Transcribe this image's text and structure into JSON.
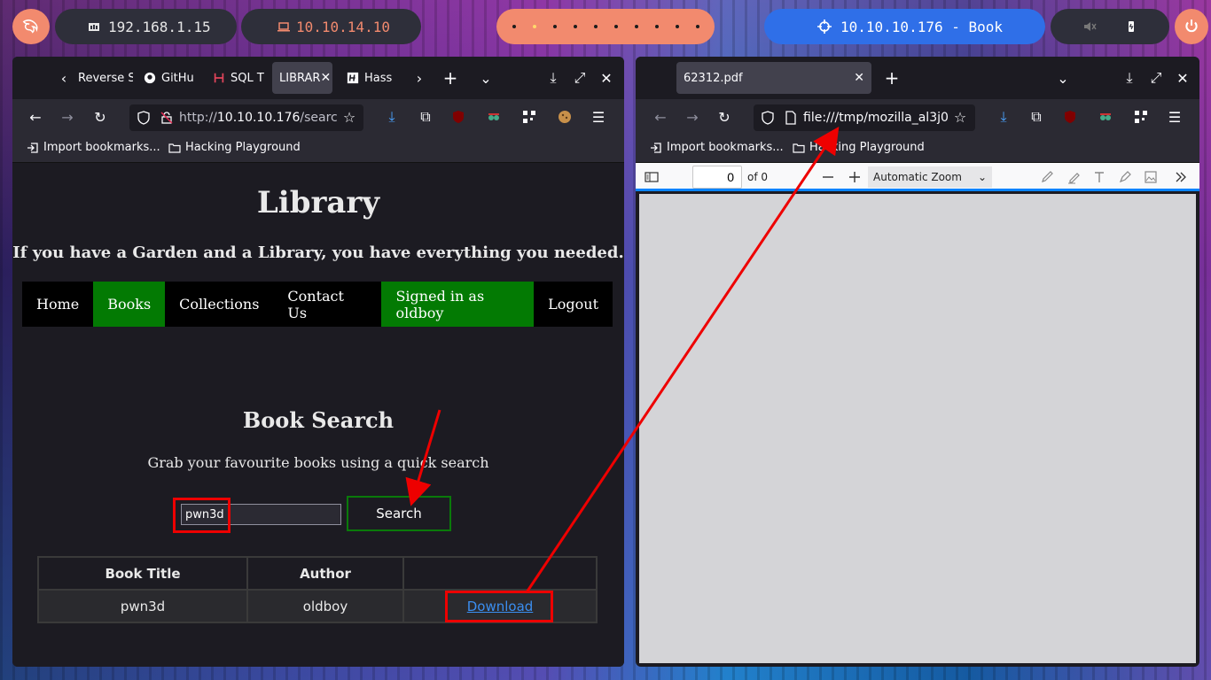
{
  "topbar": {
    "ip_local": "192.168.1.15",
    "ip_vpn": "10.10.14.10",
    "target": "10.10.10.176 - Book"
  },
  "left_browser": {
    "tabs": [
      "Reverse S",
      "GitHu",
      "SQL T",
      "LIBRAR",
      "Hass"
    ],
    "url_prefix": "http://",
    "url_host": "10.10.10.176",
    "url_path": "/searc",
    "bookmarks": [
      "Import bookmarks...",
      "Hacking Playground"
    ]
  },
  "page": {
    "title": "Library",
    "subtitle": "If you have a Garden and a Library, you have everything you needed.",
    "nav": [
      "Home",
      "Books",
      "Collections",
      "Contact Us",
      "Signed in as oldboy",
      "Logout"
    ],
    "search_title": "Book Search",
    "search_sub": "Grab your favourite books using a quick search",
    "search_value": "pwn3d",
    "search_button": "Search",
    "table_headers": [
      "Book Title",
      "Author",
      ""
    ],
    "rows": [
      {
        "title": "pwn3d",
        "author": "oldboy",
        "action": "Download"
      }
    ]
  },
  "right_browser": {
    "tab_title": "62312.pdf",
    "url": "file:///tmp/mozilla_al3j0",
    "bookmarks": [
      "Import bookmarks...",
      "Hacking Playground"
    ],
    "pdf_page": "0",
    "pdf_of": "of 0",
    "zoom": "Automatic Zoom"
  },
  "colors": {
    "accent_orange": "#f28a6e",
    "target_blue": "#2f6fe8",
    "nav_green": "#037a03",
    "annotation_red": "#e00000"
  }
}
